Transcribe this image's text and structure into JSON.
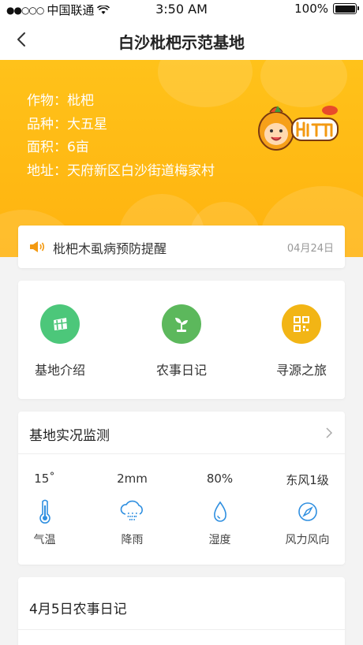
{
  "status_bar": {
    "carrier": "中国联通",
    "time": "3:50 AM",
    "battery": "100%"
  },
  "nav": {
    "title": "白沙枇杷示范基地"
  },
  "hero": {
    "rows": [
      "作物：枇杷",
      "品种：大五星",
      "面积：6亩",
      "地址：天府新区白沙街道梅家村"
    ],
    "logo_icon": "loquat-mascot-logo"
  },
  "notice": {
    "text": "枇杷木虱病预防提醒",
    "date": "04月24日"
  },
  "features": [
    {
      "label": "基地介绍",
      "icon": "map-icon",
      "color": "#4cc77a"
    },
    {
      "label": "农事日记",
      "icon": "sprout-icon",
      "color": "#5cb85c"
    },
    {
      "label": "寻源之旅",
      "icon": "qr-code-icon",
      "color": "#f2b515"
    }
  ],
  "monitor": {
    "title": "基地实况监测",
    "metrics": [
      {
        "value": "15˚",
        "name": "气温",
        "icon": "thermometer-icon"
      },
      {
        "value": "2mm",
        "name": "降雨",
        "icon": "rain-cloud-icon"
      },
      {
        "value": "80%",
        "name": "湿度",
        "icon": "water-drop-icon"
      },
      {
        "value": "东风1级",
        "name": "风力风向",
        "icon": "compass-icon"
      }
    ],
    "icon_color": "#2f8fe0"
  },
  "diary": {
    "title": "4月5日农事日记"
  }
}
